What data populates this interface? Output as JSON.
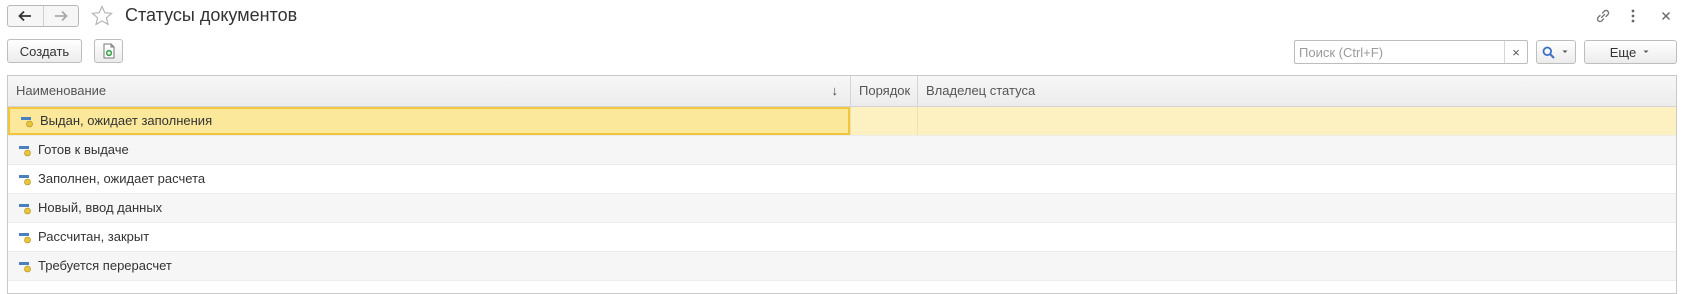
{
  "window": {
    "title": "Статусы документов"
  },
  "toolbar": {
    "create_label": "Создать",
    "search_placeholder": "Поиск (Ctrl+F)",
    "clear_label": "×",
    "more_label": "Еще"
  },
  "table": {
    "columns": [
      "Наименование",
      "Порядок",
      "Владелец статуса"
    ],
    "sorted_column": "Наименование",
    "sort_direction": "descending",
    "rows": [
      {
        "name": "Выдан, ожидает заполнения",
        "order": "",
        "owner": ""
      },
      {
        "name": "Готов к выдаче",
        "order": "",
        "owner": ""
      },
      {
        "name": "Заполнен, ожидает расчета",
        "order": "",
        "owner": ""
      },
      {
        "name": "Новый, ввод данных",
        "order": "",
        "owner": ""
      },
      {
        "name": "Рассчитан, закрыт",
        "order": "",
        "owner": ""
      },
      {
        "name": "Требуется перерасчет",
        "order": "",
        "owner": ""
      }
    ],
    "selected_row": 0
  },
  "icons": {
    "back": "arrow-left-icon",
    "forward": "arrow-right-icon",
    "favorite": "star-icon",
    "link": "link-icon",
    "menu": "more-vertical-icon",
    "close": "close-icon",
    "add_copy": "document-add-icon",
    "search": "search-icon",
    "row_item": "catalog-item-icon"
  },
  "colors": {
    "selected_row": "#fdf1c2",
    "selected_cell_border": "#f2c63c",
    "accent_blue": "#3b6fc4"
  }
}
